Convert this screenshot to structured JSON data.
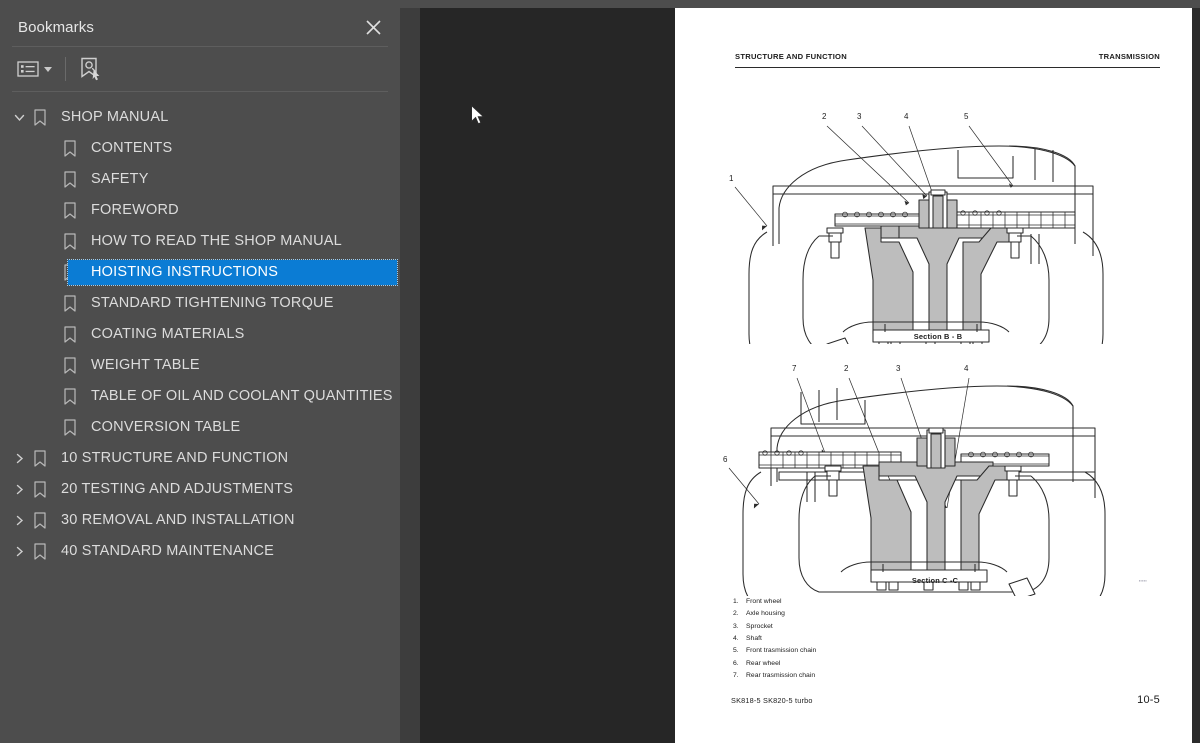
{
  "sidebar": {
    "title": "Bookmarks",
    "close_icon": "close-icon",
    "toolbar": {
      "options_label": "options-list-icon",
      "options_caret": "chevron-down-icon",
      "find_bookmark_label": "find-bookmark-icon"
    },
    "tree": [
      {
        "label": "SHOP MANUAL",
        "level": 1,
        "expandable": true,
        "expanded": true,
        "selected": false
      },
      {
        "label": "CONTENTS",
        "level": 2,
        "expandable": false,
        "expanded": false,
        "selected": false
      },
      {
        "label": "SAFETY",
        "level": 2,
        "expandable": false,
        "expanded": false,
        "selected": false
      },
      {
        "label": "FOREWORD",
        "level": 2,
        "expandable": false,
        "expanded": false,
        "selected": false
      },
      {
        "label": "HOW TO READ THE SHOP MANUAL",
        "level": 2,
        "expandable": false,
        "expanded": false,
        "selected": false
      },
      {
        "label": "HOISTING INSTRUCTIONS",
        "level": 2,
        "expandable": false,
        "expanded": false,
        "selected": true
      },
      {
        "label": "STANDARD TIGHTENING TORQUE",
        "level": 2,
        "expandable": false,
        "expanded": false,
        "selected": false
      },
      {
        "label": "COATING MATERIALS",
        "level": 2,
        "expandable": false,
        "expanded": false,
        "selected": false
      },
      {
        "label": "WEIGHT TABLE",
        "level": 2,
        "expandable": false,
        "expanded": false,
        "selected": false
      },
      {
        "label": "TABLE OF OIL AND COOLANT QUANTITIES",
        "level": 2,
        "expandable": false,
        "expanded": false,
        "selected": false
      },
      {
        "label": "CONVERSION TABLE",
        "level": 2,
        "expandable": false,
        "expanded": false,
        "selected": false
      },
      {
        "label": "10 STRUCTURE AND FUNCTION",
        "level": 1,
        "expandable": true,
        "expanded": false,
        "selected": false
      },
      {
        "label": "20 TESTING AND ADJUSTMENTS",
        "level": 1,
        "expandable": true,
        "expanded": false,
        "selected": false
      },
      {
        "label": "30 REMOVAL AND INSTALLATION",
        "level": 1,
        "expandable": true,
        "expanded": false,
        "selected": false
      },
      {
        "label": "40 STANDARD MAINTENANCE",
        "level": 1,
        "expandable": true,
        "expanded": false,
        "selected": false
      }
    ]
  },
  "divider": {
    "collapse_icon": "collapse-left-icon"
  },
  "page": {
    "header_left": "STRUCTURE AND FUNCTION",
    "header_right": "TRANSMISSION",
    "figures": [
      {
        "caption": "Section B - B",
        "callouts": [
          "1",
          "2",
          "3",
          "4",
          "5"
        ]
      },
      {
        "caption": "Section C -C",
        "callouts": [
          "6",
          "7",
          "2",
          "3",
          "4"
        ]
      }
    ],
    "figure_id": "",
    "legend": [
      {
        "num": "1.",
        "text": "Front wheel"
      },
      {
        "num": "2.",
        "text": "Axle housing"
      },
      {
        "num": "3.",
        "text": "Sprocket"
      },
      {
        "num": "4.",
        "text": "Shaft"
      },
      {
        "num": "5.",
        "text": "Front trasmission chain"
      },
      {
        "num": "6.",
        "text": "Rear wheel"
      },
      {
        "num": "7.",
        "text": "Rear trasmission chain"
      }
    ],
    "footer_left": "SK818-5  SK820-5 turbo",
    "footer_right": "10-5"
  },
  "colors": {
    "sidebar_bg": "#4d4d4d",
    "viewer_bg": "#262626",
    "selection_blue": "#0b7cd4",
    "text": "#dcdcdc",
    "page_bg": "#ffffff"
  }
}
